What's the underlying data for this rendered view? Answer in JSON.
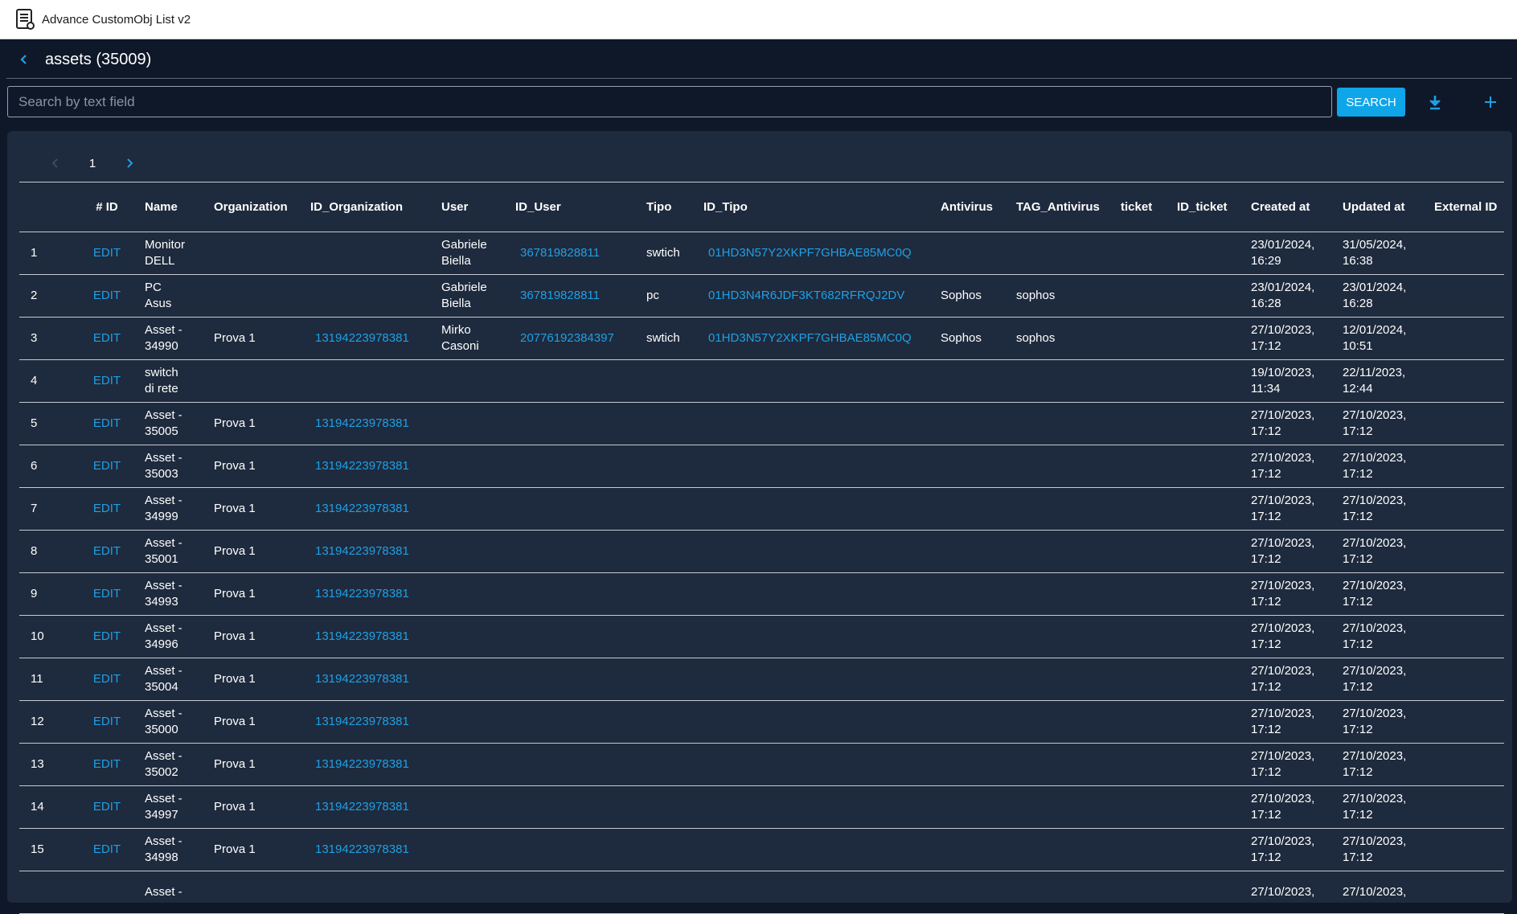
{
  "app": {
    "title": "Advance CustomObj List v2"
  },
  "header": {
    "title": "assets (35009)"
  },
  "search": {
    "placeholder": "Search by text field",
    "value": "",
    "button_label": "SEARCH"
  },
  "pagination": {
    "current_page": "1"
  },
  "colors": {
    "accent": "#1ea0e6",
    "button": "#0ea5e9",
    "background": "#0f1829",
    "panel": "#1e2a3d"
  },
  "icons": {
    "back": "chevron-left-icon",
    "download": "download-icon",
    "add": "plus-icon",
    "prev": "chevron-left-icon",
    "next": "chevron-right-icon"
  },
  "table": {
    "headers": [
      "",
      "# ID",
      "Name",
      "Organization",
      "ID_Organization",
      "User",
      "ID_User",
      "Tipo",
      "ID_Tipo",
      "Antivirus",
      "TAG_Antivirus",
      "ticket",
      "ID_ticket",
      "Created at",
      "Updated at",
      "External ID"
    ],
    "edit_label": "EDIT",
    "rows": [
      {
        "n": "1",
        "name": "Monitor\nDELL",
        "org": "",
        "id_org": "",
        "user": "Gabriele\nBiella",
        "id_user": "367819828811",
        "tipo": "swtich",
        "id_tipo": "01HD3N57Y2XKPF7GHBAE85MC0Q",
        "antivirus": "",
        "tag_antivirus": "",
        "ticket": "",
        "id_ticket": "",
        "created": "23/01/2024,\n16:29",
        "updated": "31/05/2024,\n16:38",
        "external_id": ""
      },
      {
        "n": "2",
        "name": "PC\nAsus",
        "org": "",
        "id_org": "",
        "user": "Gabriele\nBiella",
        "id_user": "367819828811",
        "tipo": "pc",
        "id_tipo": "01HD3N4R6JDF3KT682RFRQJ2DV",
        "antivirus": "Sophos",
        "tag_antivirus": "sophos",
        "ticket": "",
        "id_ticket": "",
        "created": "23/01/2024,\n16:28",
        "updated": "23/01/2024,\n16:28",
        "external_id": ""
      },
      {
        "n": "3",
        "name": "Asset -\n34990",
        "org": "Prova 1",
        "id_org": "13194223978381",
        "user": "Mirko\nCasoni",
        "id_user": "20776192384397",
        "tipo": "swtich",
        "id_tipo": "01HD3N57Y2XKPF7GHBAE85MC0Q",
        "antivirus": "Sophos",
        "tag_antivirus": "sophos",
        "ticket": "",
        "id_ticket": "",
        "created": "27/10/2023,\n17:12",
        "updated": "12/01/2024,\n10:51",
        "external_id": ""
      },
      {
        "n": "4",
        "name": "switch\ndi rete",
        "org": "",
        "id_org": "",
        "user": "",
        "id_user": "",
        "tipo": "",
        "id_tipo": "",
        "antivirus": "",
        "tag_antivirus": "",
        "ticket": "",
        "id_ticket": "",
        "created": "19/10/2023,\n11:34",
        "updated": "22/11/2023,\n12:44",
        "external_id": ""
      },
      {
        "n": "5",
        "name": "Asset -\n35005",
        "org": "Prova 1",
        "id_org": "13194223978381",
        "user": "",
        "id_user": "",
        "tipo": "",
        "id_tipo": "",
        "antivirus": "",
        "tag_antivirus": "",
        "ticket": "",
        "id_ticket": "",
        "created": "27/10/2023,\n17:12",
        "updated": "27/10/2023,\n17:12",
        "external_id": ""
      },
      {
        "n": "6",
        "name": "Asset -\n35003",
        "org": "Prova 1",
        "id_org": "13194223978381",
        "user": "",
        "id_user": "",
        "tipo": "",
        "id_tipo": "",
        "antivirus": "",
        "tag_antivirus": "",
        "ticket": "",
        "id_ticket": "",
        "created": "27/10/2023,\n17:12",
        "updated": "27/10/2023,\n17:12",
        "external_id": ""
      },
      {
        "n": "7",
        "name": "Asset -\n34999",
        "org": "Prova 1",
        "id_org": "13194223978381",
        "user": "",
        "id_user": "",
        "tipo": "",
        "id_tipo": "",
        "antivirus": "",
        "tag_antivirus": "",
        "ticket": "",
        "id_ticket": "",
        "created": "27/10/2023,\n17:12",
        "updated": "27/10/2023,\n17:12",
        "external_id": ""
      },
      {
        "n": "8",
        "name": "Asset -\n35001",
        "org": "Prova 1",
        "id_org": "13194223978381",
        "user": "",
        "id_user": "",
        "tipo": "",
        "id_tipo": "",
        "antivirus": "",
        "tag_antivirus": "",
        "ticket": "",
        "id_ticket": "",
        "created": "27/10/2023,\n17:12",
        "updated": "27/10/2023,\n17:12",
        "external_id": ""
      },
      {
        "n": "9",
        "name": "Asset -\n34993",
        "org": "Prova 1",
        "id_org": "13194223978381",
        "user": "",
        "id_user": "",
        "tipo": "",
        "id_tipo": "",
        "antivirus": "",
        "tag_antivirus": "",
        "ticket": "",
        "id_ticket": "",
        "created": "27/10/2023,\n17:12",
        "updated": "27/10/2023,\n17:12",
        "external_id": ""
      },
      {
        "n": "10",
        "name": "Asset -\n34996",
        "org": "Prova 1",
        "id_org": "13194223978381",
        "user": "",
        "id_user": "",
        "tipo": "",
        "id_tipo": "",
        "antivirus": "",
        "tag_antivirus": "",
        "ticket": "",
        "id_ticket": "",
        "created": "27/10/2023,\n17:12",
        "updated": "27/10/2023,\n17:12",
        "external_id": ""
      },
      {
        "n": "11",
        "name": "Asset -\n35004",
        "org": "Prova 1",
        "id_org": "13194223978381",
        "user": "",
        "id_user": "",
        "tipo": "",
        "id_tipo": "",
        "antivirus": "",
        "tag_antivirus": "",
        "ticket": "",
        "id_ticket": "",
        "created": "27/10/2023,\n17:12",
        "updated": "27/10/2023,\n17:12",
        "external_id": ""
      },
      {
        "n": "12",
        "name": "Asset -\n35000",
        "org": "Prova 1",
        "id_org": "13194223978381",
        "user": "",
        "id_user": "",
        "tipo": "",
        "id_tipo": "",
        "antivirus": "",
        "tag_antivirus": "",
        "ticket": "",
        "id_ticket": "",
        "created": "27/10/2023,\n17:12",
        "updated": "27/10/2023,\n17:12",
        "external_id": ""
      },
      {
        "n": "13",
        "name": "Asset -\n35002",
        "org": "Prova 1",
        "id_org": "13194223978381",
        "user": "",
        "id_user": "",
        "tipo": "",
        "id_tipo": "",
        "antivirus": "",
        "tag_antivirus": "",
        "ticket": "",
        "id_ticket": "",
        "created": "27/10/2023,\n17:12",
        "updated": "27/10/2023,\n17:12",
        "external_id": ""
      },
      {
        "n": "14",
        "name": "Asset -\n34997",
        "org": "Prova 1",
        "id_org": "13194223978381",
        "user": "",
        "id_user": "",
        "tipo": "",
        "id_tipo": "",
        "antivirus": "",
        "tag_antivirus": "",
        "ticket": "",
        "id_ticket": "",
        "created": "27/10/2023,\n17:12",
        "updated": "27/10/2023,\n17:12",
        "external_id": ""
      },
      {
        "n": "15",
        "name": "Asset -\n34998",
        "org": "Prova 1",
        "id_org": "13194223978381",
        "user": "",
        "id_user": "",
        "tipo": "",
        "id_tipo": "",
        "antivirus": "",
        "tag_antivirus": "",
        "ticket": "",
        "id_ticket": "",
        "created": "27/10/2023,\n17:12",
        "updated": "27/10/2023,\n17:12",
        "external_id": ""
      },
      {
        "n": "",
        "name": "Asset -",
        "org": "",
        "id_org": "",
        "user": "",
        "id_user": "",
        "tipo": "",
        "id_tipo": "",
        "antivirus": "",
        "tag_antivirus": "",
        "ticket": "",
        "id_ticket": "",
        "created": "27/10/2023,",
        "updated": "27/10/2023,",
        "external_id": ""
      }
    ]
  }
}
